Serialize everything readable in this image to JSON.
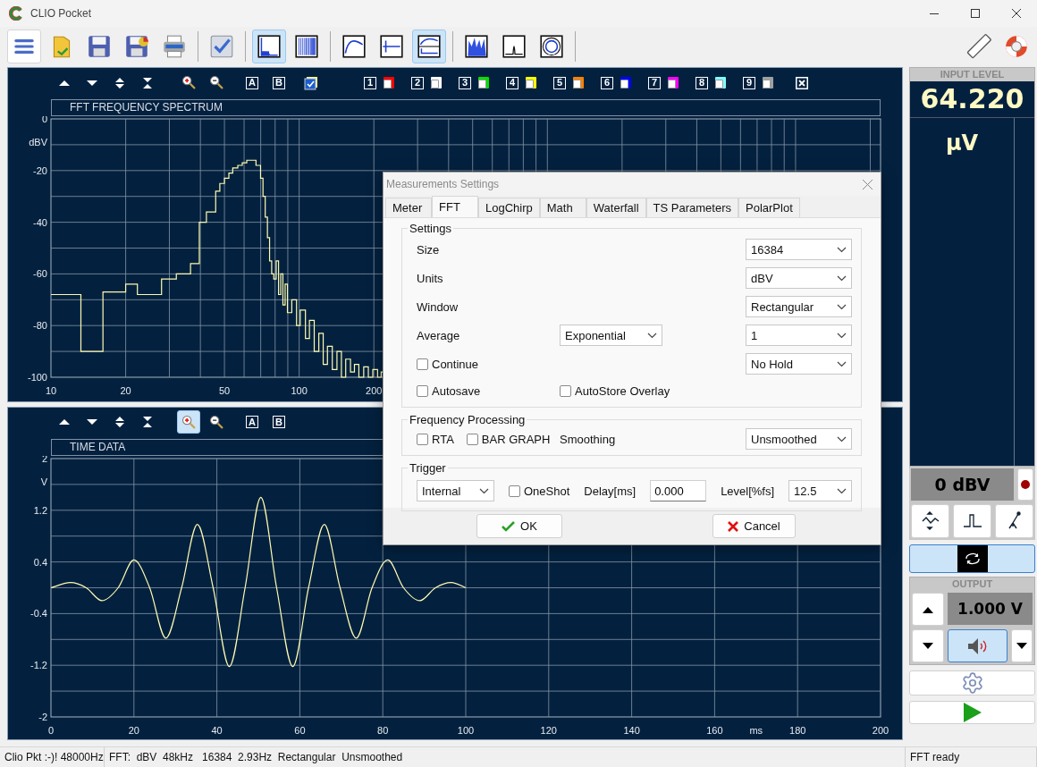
{
  "window": {
    "title": "CLIO Pocket"
  },
  "toolbar": [
    [
      {
        "kind": "menu",
        "selected": false
      },
      {
        "kind": "open",
        "selected": false
      },
      {
        "kind": "save",
        "selected": false
      },
      {
        "kind": "save-as",
        "selected": false
      },
      {
        "kind": "print",
        "selected": false
      }
    ],
    [
      {
        "kind": "check",
        "selected": false
      }
    ],
    [
      {
        "kind": "fft",
        "selected": true
      },
      {
        "kind": "sweep",
        "selected": false
      }
    ],
    [
      {
        "kind": "curve",
        "selected": false
      },
      {
        "kind": "impulse",
        "selected": false
      },
      {
        "kind": "dual",
        "selected": true
      }
    ],
    [
      {
        "kind": "waterfall",
        "selected": false
      },
      {
        "kind": "peak",
        "selected": false
      },
      {
        "kind": "polar",
        "selected": false
      }
    ]
  ],
  "toolbar_right": [
    {
      "kind": "ruler",
      "selected": false
    },
    {
      "kind": "help",
      "selected": false
    }
  ],
  "charts": [
    {
      "tools": [
        {
          "kind": "up",
          "selected": false
        },
        {
          "kind": "down",
          "selected": false
        },
        {
          "kind": "expand",
          "selected": false
        },
        {
          "kind": "shrink",
          "selected": false
        },
        {
          "kind": "zoom-in",
          "selected": false
        },
        {
          "kind": "zoom-out",
          "selected": false
        }
      ],
      "markers": [
        "A",
        "B"
      ],
      "overlay": {
        "checked": true
      },
      "memories": [
        {
          "label": "1",
          "color": "#ff0000"
        },
        {
          "label": "2",
          "color": "#ffffff"
        },
        {
          "label": "3",
          "color": "#00e000"
        },
        {
          "label": "4",
          "color": "#ffff00"
        },
        {
          "label": "5",
          "color": "#ff8000"
        },
        {
          "label": "6",
          "color": "#0000ff"
        },
        {
          "label": "7",
          "color": "#ff00ff"
        },
        {
          "label": "8",
          "color": "#80ffff"
        },
        {
          "label": "9",
          "color": "#a0a0a0"
        }
      ],
      "title": "FFT FREQUENCY SPECTRUM",
      "plot": {
        "ylabel": "dBV",
        "yticks": [
          "0",
          "-20",
          "-40",
          "-60",
          "-80",
          "-100"
        ],
        "xticks": [
          "10",
          "20",
          "50",
          "100",
          "200"
        ]
      }
    },
    {
      "tools": [
        {
          "kind": "up",
          "selected": false
        },
        {
          "kind": "down",
          "selected": false
        },
        {
          "kind": "expand",
          "selected": false
        },
        {
          "kind": "shrink",
          "selected": false
        },
        {
          "kind": "zoom-in",
          "selected": true
        },
        {
          "kind": "zoom-out",
          "selected": false
        }
      ],
      "markers": [
        "A",
        "B"
      ],
      "title": "TIME DATA",
      "chart_data": {
        "type": "line",
        "grid": true,
        "ylabel": "V",
        "xlabel": "ms",
        "xlim": [
          0,
          200
        ],
        "ylim": [
          -2,
          2
        ],
        "xticks": [
          0,
          20,
          40,
          60,
          80,
          100,
          120,
          140,
          160,
          180,
          200
        ],
        "yticks": [
          2,
          1.2,
          0.4,
          -0.4,
          -1.2,
          -2
        ],
        "x": [
          0,
          4.7,
          8.5,
          12.3,
          16.2,
          20,
          23.8,
          27.7,
          31.5,
          35.3,
          39.1,
          43,
          46.8,
          50.6,
          54.4,
          58.3,
          62.1,
          65.9,
          69.7,
          73.6,
          77.4,
          81.2,
          85,
          88.9,
          92.7,
          96.5,
          100
        ],
        "series": [
          {
            "color": "#fffbb0",
            "values": [
              0,
              0.08,
              0,
              -0.2,
              0,
              0.43,
              0,
              -0.78,
              0,
              0.98,
              0,
              -1.22,
              0,
              1.4,
              0,
              -1.22,
              0,
              0.98,
              0,
              -0.78,
              0,
              0.43,
              0,
              -0.2,
              0,
              0.08,
              0
            ]
          }
        ]
      }
    }
  ],
  "input_level": {
    "title": "INPUT LEVEL",
    "value": "64.220",
    "unit": "µV",
    "range": "0 dBV"
  },
  "input_buttons": [
    {
      "kind": "filter",
      "selected": false
    },
    {
      "kind": "impulse",
      "selected": false
    },
    {
      "kind": "mic",
      "selected": false
    }
  ],
  "loop": {
    "selected": true
  },
  "output": {
    "title": "OUTPUT",
    "value": "1.000 V",
    "speaker_selected": true
  },
  "status_bar": [
    "Clio Pkt :-)! 48000Hz",
    "FFT:  dBV  48kHz   16384  2.93Hz  Rectangular  Unsmoothed",
    "FFT ready"
  ],
  "dialog": {
    "title": "Measurements Settings",
    "tabs": [
      {
        "label": "Meter",
        "selected": false
      },
      {
        "label": "FFT",
        "selected": true
      },
      {
        "label": "LogChirp",
        "selected": false
      },
      {
        "label": "Math",
        "selected": false
      },
      {
        "label": "Waterfall",
        "selected": false
      },
      {
        "label": "TS Parameters",
        "selected": false
      },
      {
        "label": "PolarPlot",
        "selected": false
      }
    ],
    "groups": [
      {
        "title": "Settings",
        "kind": "form",
        "rows": [
          {
            "left": [
              {
                "kind": "label",
                "text": "Size"
              }
            ],
            "right": [
              {
                "kind": "select",
                "value": "16384"
              }
            ]
          },
          {
            "left": [
              {
                "kind": "label",
                "text": "Units"
              }
            ],
            "right": [
              {
                "kind": "select",
                "value": "dBV"
              }
            ]
          },
          {
            "left": [
              {
                "kind": "label",
                "text": "Window"
              }
            ],
            "right": [
              {
                "kind": "select",
                "value": "Rectangular"
              }
            ]
          },
          {
            "left": [
              {
                "kind": "label",
                "text": "Average"
              }
            ],
            "middle": [
              {
                "kind": "select",
                "value": "Exponential"
              }
            ],
            "right": [
              {
                "kind": "select",
                "value": "1"
              }
            ]
          },
          {
            "left": [
              {
                "kind": "checkbox",
                "label": "Continue",
                "checked": false
              }
            ],
            "right": [
              {
                "kind": "select",
                "value": "No Hold"
              }
            ]
          },
          {
            "left": [
              {
                "kind": "checkbox",
                "label": "Autosave",
                "checked": false
              }
            ],
            "middle": [
              {
                "kind": "checkbox",
                "label": "AutoStore Overlay",
                "checked": false
              }
            ]
          }
        ]
      },
      {
        "title": "Frequency Processing",
        "kind": "form",
        "rows": [
          {
            "left": [
              {
                "kind": "checkbox",
                "label": "RTA",
                "checked": false
              },
              {
                "kind": "checkbox",
                "label": "BAR GRAPH",
                "checked": false
              }
            ],
            "middle": [
              {
                "kind": "label",
                "text": "Smoothing"
              }
            ],
            "right": [
              {
                "kind": "select",
                "value": "Unsmoothed"
              }
            ]
          }
        ]
      },
      {
        "title": "Trigger",
        "kind": "inline",
        "cells": [
          {
            "kind": "select",
            "value": "Internal"
          },
          {
            "kind": "checkbox",
            "label": "OneShot",
            "checked": false
          },
          {
            "kind": "label",
            "text": "Delay[ms]"
          },
          {
            "kind": "input",
            "value": "0.000"
          },
          {
            "kind": "label",
            "text": "Level[%fs]"
          },
          {
            "kind": "select",
            "value": "12.5"
          }
        ]
      }
    ],
    "buttons": [
      {
        "kind": "ok",
        "label": "OK"
      },
      {
        "kind": "cancel",
        "label": "Cancel"
      }
    ]
  }
}
